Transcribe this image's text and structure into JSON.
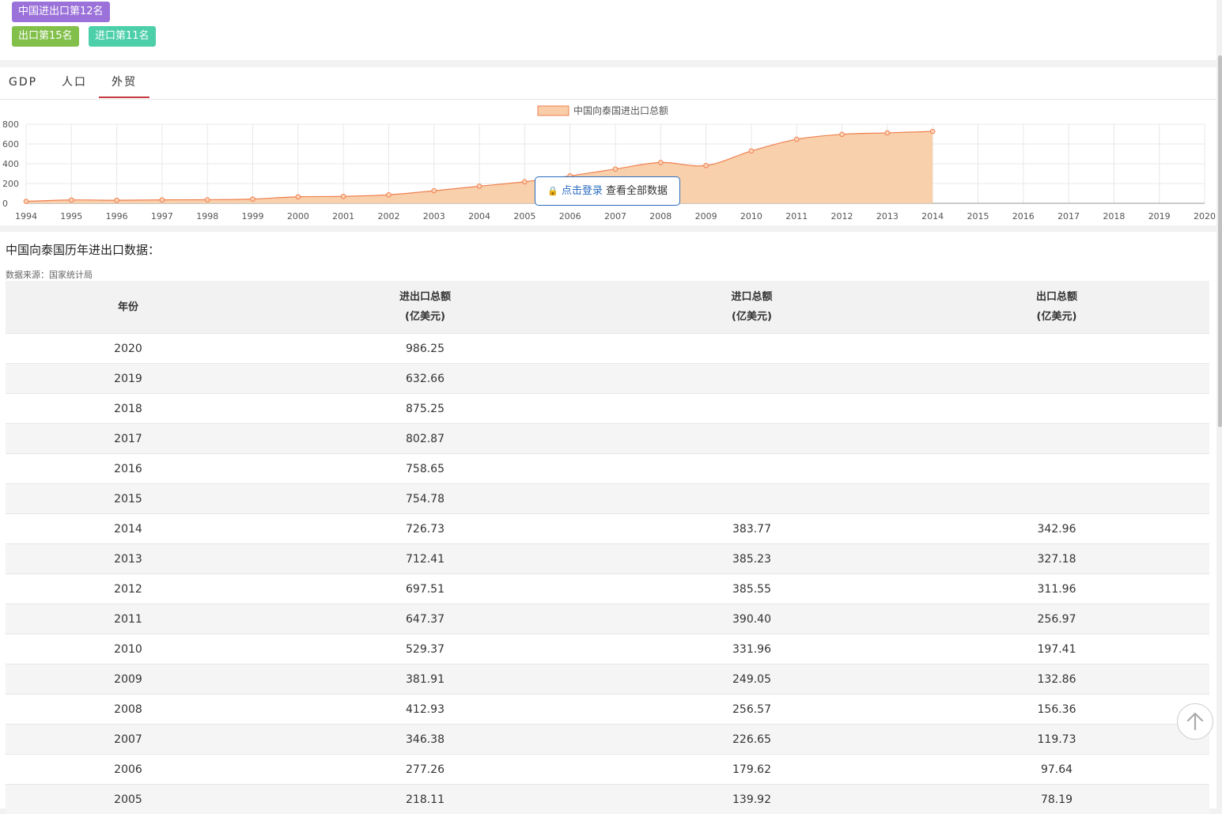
{
  "badges": {
    "total": "中国进出口第12名",
    "export": "出口第15名",
    "import": "进口第11名"
  },
  "tabs": [
    "GDP",
    "人口",
    "外贸"
  ],
  "active_tab": "外贸",
  "login_prompt": {
    "link": "点击登录",
    "text": "查看全部数据"
  },
  "table": {
    "title": "中国向泰国历年进出口数据：",
    "source": "数据来源：国家统计局",
    "headers": [
      {
        "line1": "年份",
        "line2": ""
      },
      {
        "line1": "进出口总额",
        "line2": "(亿美元)"
      },
      {
        "line1": "进口总额",
        "line2": "(亿美元)"
      },
      {
        "line1": "出口总额",
        "line2": "(亿美元)"
      }
    ],
    "rows": [
      [
        "2020",
        "986.25",
        "",
        ""
      ],
      [
        "2019",
        "632.66",
        "",
        ""
      ],
      [
        "2018",
        "875.25",
        "",
        ""
      ],
      [
        "2017",
        "802.87",
        "",
        ""
      ],
      [
        "2016",
        "758.65",
        "",
        ""
      ],
      [
        "2015",
        "754.78",
        "",
        ""
      ],
      [
        "2014",
        "726.73",
        "383.77",
        "342.96"
      ],
      [
        "2013",
        "712.41",
        "385.23",
        "327.18"
      ],
      [
        "2012",
        "697.51",
        "385.55",
        "311.96"
      ],
      [
        "2011",
        "647.37",
        "390.40",
        "256.97"
      ],
      [
        "2010",
        "529.37",
        "331.96",
        "197.41"
      ],
      [
        "2009",
        "381.91",
        "249.05",
        "132.86"
      ],
      [
        "2008",
        "412.93",
        "256.57",
        "156.36"
      ],
      [
        "2007",
        "346.38",
        "226.65",
        "119.73"
      ],
      [
        "2006",
        "277.26",
        "179.62",
        "97.64"
      ],
      [
        "2005",
        "218.11",
        "139.92",
        "78.19"
      ]
    ]
  },
  "chart_data": {
    "type": "area",
    "legend": [
      "中国向泰国进出口总额"
    ],
    "legend_position": "top-center",
    "x": [
      "1994",
      "1995",
      "1996",
      "1997",
      "1998",
      "1999",
      "2000",
      "2001",
      "2002",
      "2003",
      "2004",
      "2005",
      "2006",
      "2007",
      "2008",
      "2009",
      "2010",
      "2011",
      "2012",
      "2013",
      "2014",
      "2015",
      "2016",
      "2017",
      "2018",
      "2019",
      "2020"
    ],
    "series": [
      {
        "name": "中国向泰国进出口总额",
        "values": [
          20,
          34,
          31,
          35,
          36,
          43,
          66,
          70,
          86,
          127,
          173,
          218.11,
          277.26,
          346.38,
          412.93,
          381.91,
          529.37,
          647.37,
          697.51,
          712.41,
          726.73,
          null,
          null,
          null,
          null,
          null,
          null
        ]
      }
    ],
    "ylim": [
      0,
      800
    ],
    "yticks": [
      0,
      200,
      400,
      600,
      800
    ],
    "grid": true,
    "colors": {
      "line": "#f08050",
      "fill": "#f8cda8",
      "point": "#f08050"
    }
  }
}
